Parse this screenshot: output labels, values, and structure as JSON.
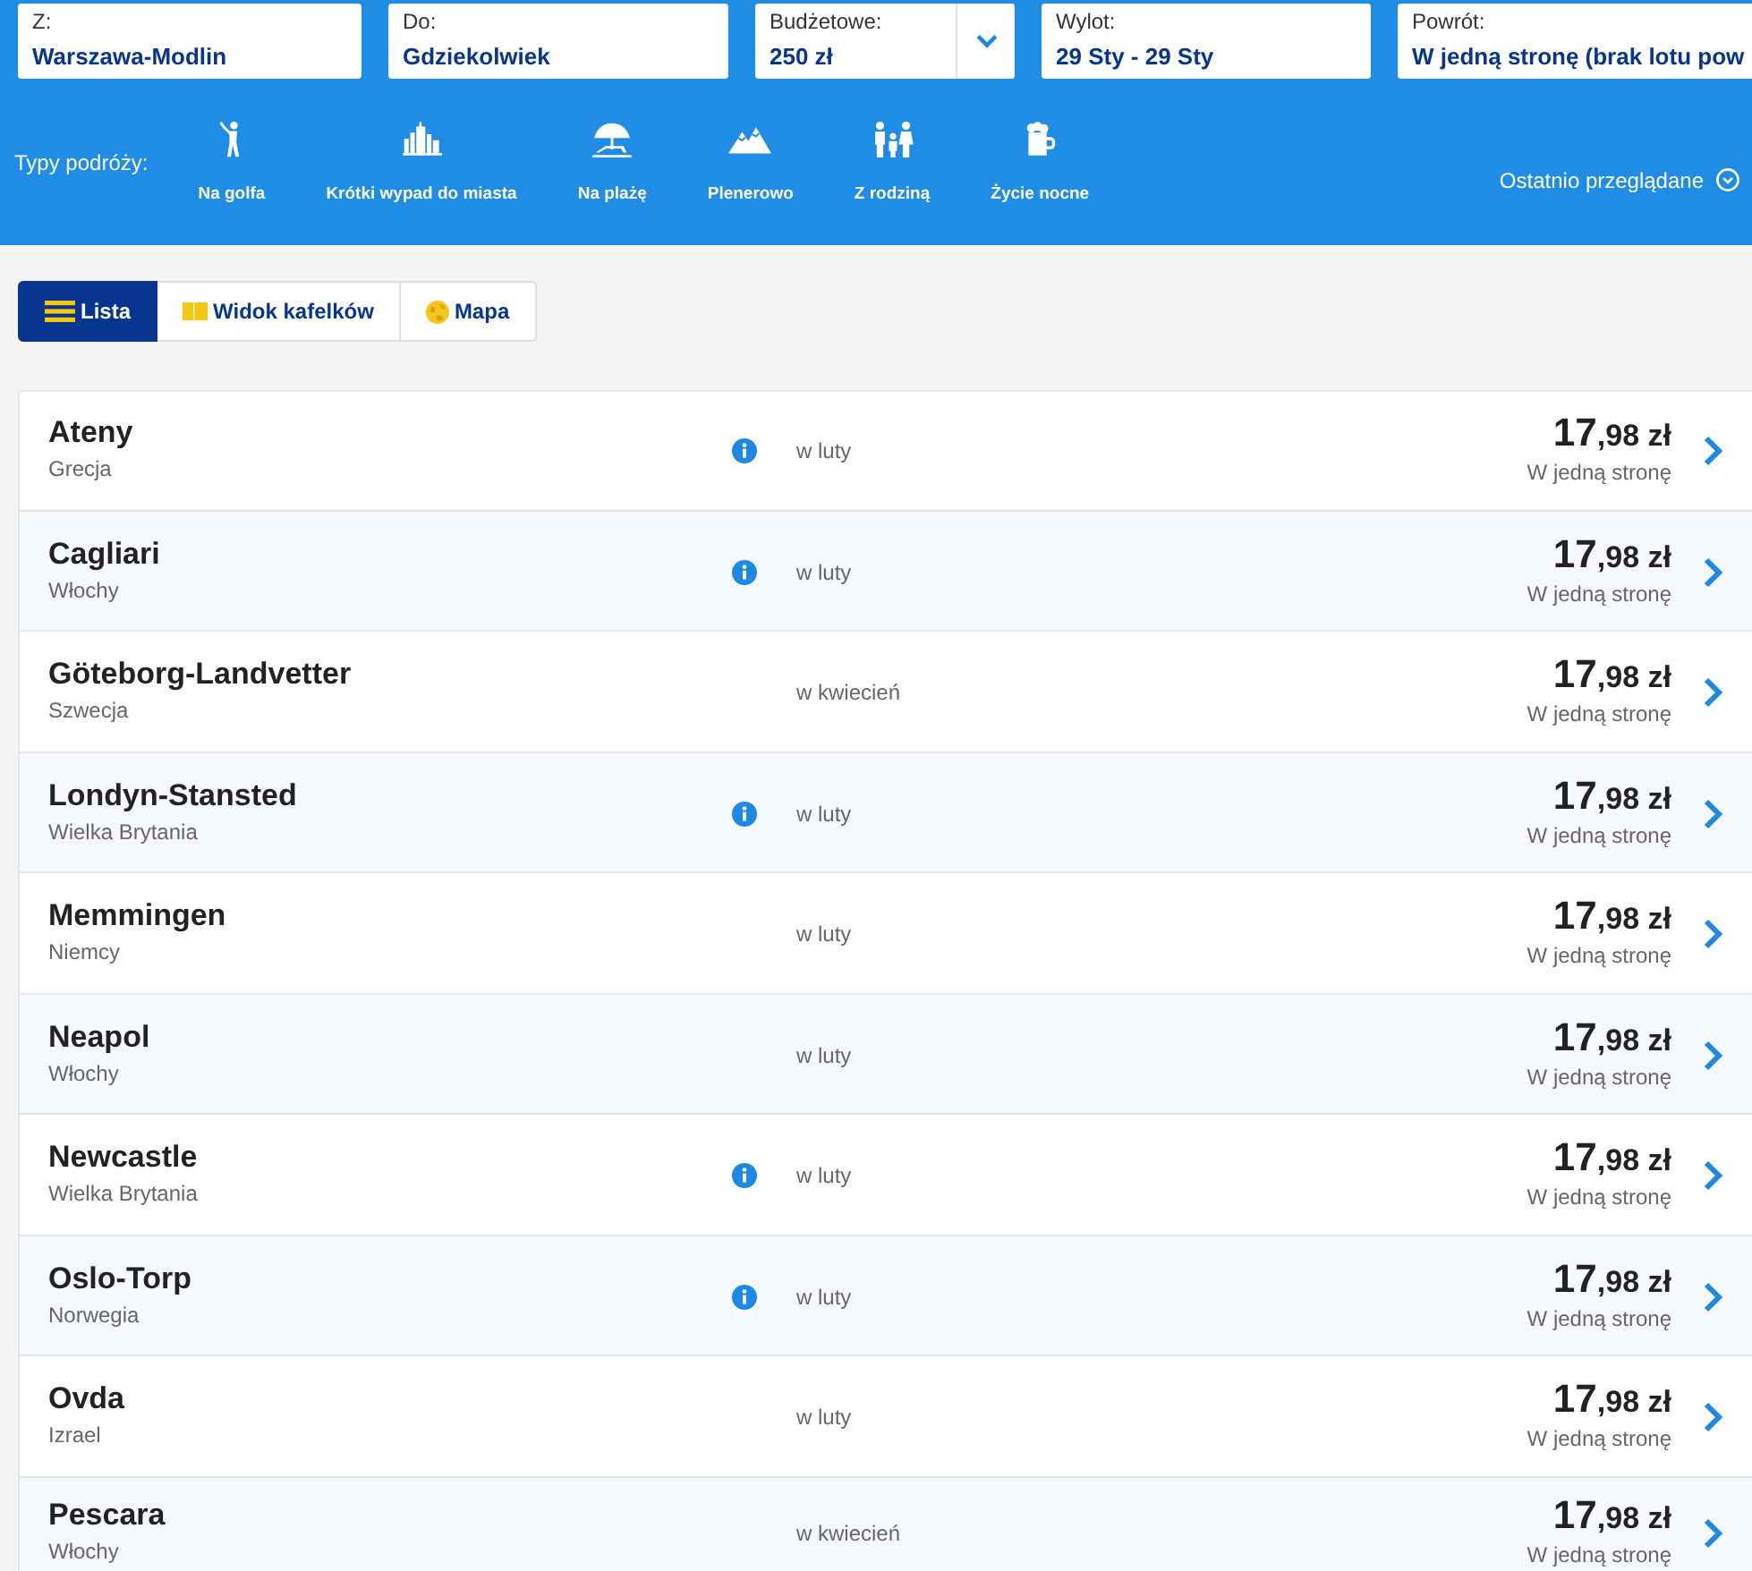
{
  "search": {
    "fields": [
      {
        "kind": "text",
        "label": "Z:",
        "value": "Warszawa-Modlin"
      },
      {
        "kind": "text",
        "label": "Do:",
        "value": "Gdziekolwiek"
      },
      {
        "kind": "select",
        "label": "Budżetowe:",
        "value": "250 zł"
      },
      {
        "kind": "text",
        "label": "Wylot:",
        "value": "29 Sty - 29 Sty"
      },
      {
        "kind": "text",
        "label": "Powrót:",
        "value": "W jedną stronę (brak lotu pow"
      }
    ]
  },
  "trip_types": {
    "label": "Typy podróży:",
    "items": [
      {
        "label": "Na golfa"
      },
      {
        "label": "Krótki wypad do miasta"
      },
      {
        "label": "Na plażę"
      },
      {
        "label": "Plenerowo"
      },
      {
        "label": "Z rodziną"
      },
      {
        "label": "Życie nocne"
      }
    ]
  },
  "recently_viewed": {
    "label": "Ostatnio przeglądane"
  },
  "view_tabs": [
    {
      "label": "Lista",
      "selected": true
    },
    {
      "label": "Widok kafelków",
      "selected": false
    },
    {
      "label": "Mapa",
      "selected": false
    }
  ],
  "destinations": [
    {
      "city": "Ateny",
      "country": "Grecja",
      "info": true,
      "month": "w luty",
      "price_whole": "17",
      "price_rest": ",98 zł",
      "fare": "W jedną stronę"
    },
    {
      "city": "Cagliari",
      "country": "Włochy",
      "info": true,
      "month": "w luty",
      "price_whole": "17",
      "price_rest": ",98 zł",
      "fare": "W jedną stronę"
    },
    {
      "city": "Göteborg-Landvetter",
      "country": "Szwecja",
      "info": false,
      "month": "w kwiecień",
      "price_whole": "17",
      "price_rest": ",98 zł",
      "fare": "W jedną stronę"
    },
    {
      "city": "Londyn-Stansted",
      "country": "Wielka Brytania",
      "info": true,
      "month": "w luty",
      "price_whole": "17",
      "price_rest": ",98 zł",
      "fare": "W jedną stronę"
    },
    {
      "city": "Memmingen",
      "country": "Niemcy",
      "info": false,
      "month": "w luty",
      "price_whole": "17",
      "price_rest": ",98 zł",
      "fare": "W jedną stronę"
    },
    {
      "city": "Neapol",
      "country": "Włochy",
      "info": false,
      "month": "w luty",
      "price_whole": "17",
      "price_rest": ",98 zł",
      "fare": "W jedną stronę"
    },
    {
      "city": "Newcastle",
      "country": "Wielka Brytania",
      "info": true,
      "month": "w luty",
      "price_whole": "17",
      "price_rest": ",98 zł",
      "fare": "W jedną stronę"
    },
    {
      "city": "Oslo-Torp",
      "country": "Norwegia",
      "info": true,
      "month": "w luty",
      "price_whole": "17",
      "price_rest": ",98 zł",
      "fare": "W jedną stronę"
    },
    {
      "city": "Ovda",
      "country": "Izrael",
      "info": false,
      "month": "w luty",
      "price_whole": "17",
      "price_rest": ",98 zł",
      "fare": "W jedną stronę"
    },
    {
      "city": "Pescara",
      "country": "Włochy",
      "info": false,
      "month": "w kwiecień",
      "price_whole": "17",
      "price_rest": ",98 zł",
      "fare": "W jedną stronę"
    }
  ]
}
